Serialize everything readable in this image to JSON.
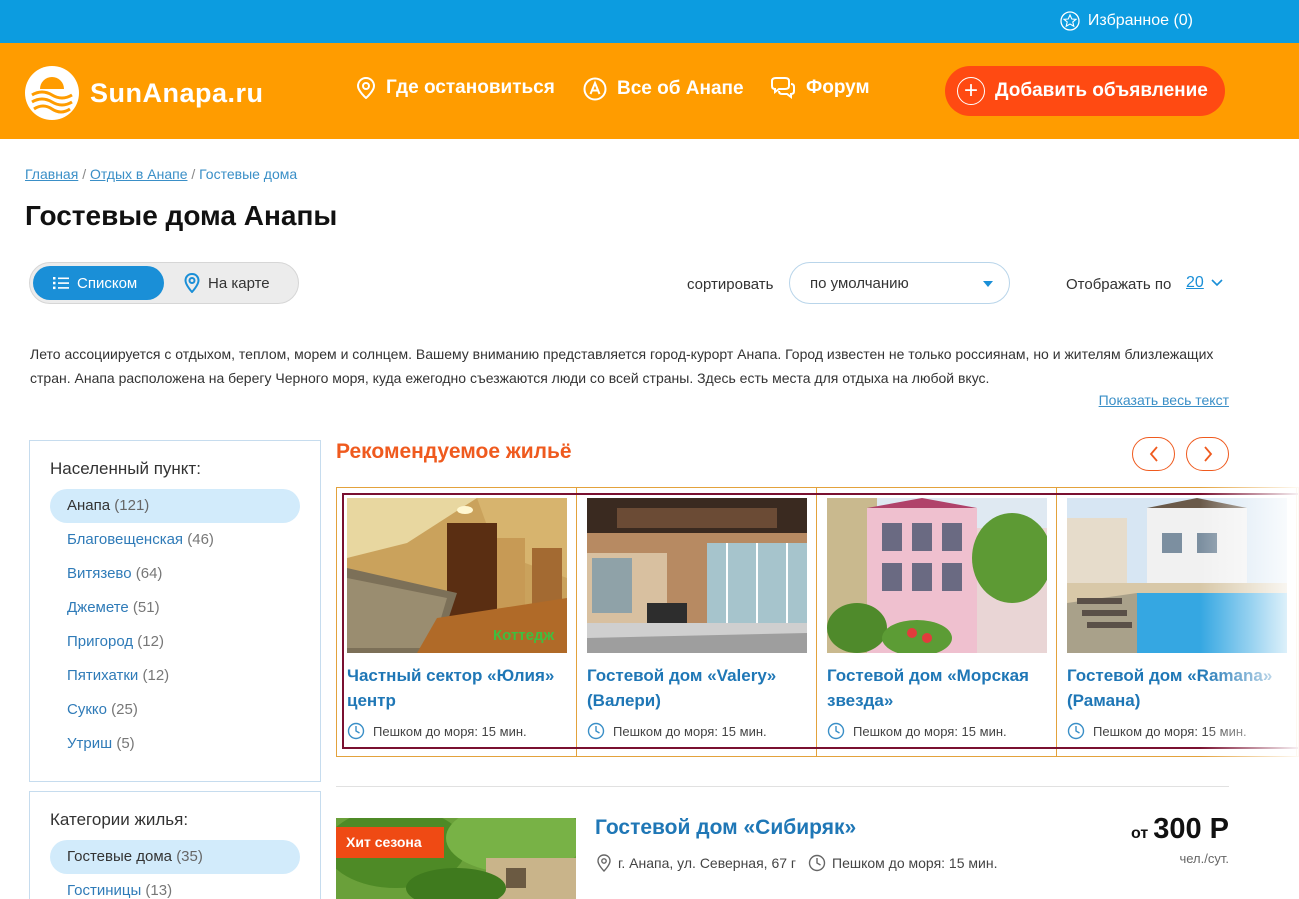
{
  "topbar": {
    "favorites_label": "Избранное (0)"
  },
  "header": {
    "logo_text": "SunAnapa.ru",
    "nav": [
      {
        "label": "Где остановиться",
        "icon": "location-pin-icon"
      },
      {
        "label": "Все об Анапе",
        "icon": "info-a-icon"
      },
      {
        "label": "Форум",
        "icon": "chat-bubbles-icon"
      }
    ],
    "add_button_label": "Добавить объявление"
  },
  "breadcrumb": {
    "items": [
      "Главная",
      "Отдых в Анапе"
    ],
    "separator": "/",
    "current": "Гостевые дома"
  },
  "page_title": "Гостевые дома Анапы",
  "view_toggle": {
    "list_label": "Списком",
    "map_label": "На карте",
    "active": "list"
  },
  "sort": {
    "label": "сортировать",
    "value": "по умолчанию"
  },
  "per_page": {
    "label": "Отображать по",
    "value": "20"
  },
  "intro": {
    "text": "Лето ассоциируется с отдыхом, теплом, морем и солнцем. Вашему вниманию представляется город-курорт Анапа. Город известен не только россиянам, но и жителям близлежащих стран. Анапа расположена на берегу Черного моря, куда ежегодно съезжаются люди со всей страны. Здесь есть места для отдыха на любой вкус.",
    "show_all_label": "Показать весь текст"
  },
  "filters": {
    "settlement": {
      "title": "Населенный пункт:",
      "items": [
        {
          "name": "Анапа",
          "count": "(121)",
          "active": true
        },
        {
          "name": "Благовещенская",
          "count": "(46)"
        },
        {
          "name": "Витязево",
          "count": "(64)"
        },
        {
          "name": "Джемете",
          "count": "(51)"
        },
        {
          "name": "Пригород",
          "count": "(12)"
        },
        {
          "name": "Пятихатки",
          "count": "(12)"
        },
        {
          "name": "Сукко",
          "count": "(25)"
        },
        {
          "name": "Утриш",
          "count": "(5)"
        }
      ]
    },
    "category": {
      "title": "Категории жилья:",
      "items": [
        {
          "name": "Гостевые дома",
          "count": "(35)",
          "active": true
        },
        {
          "name": "Гостиницы",
          "count": "(13)"
        }
      ]
    }
  },
  "recommended": {
    "title": "Рекомендуемое жильё",
    "cards": [
      {
        "title": "Частный сектор «Юлия» центр",
        "walk": "Пешком до моря: 15 мин.",
        "img_overlay": "Коттедж"
      },
      {
        "title": "Гостевой дом «Valery» (Валери)",
        "walk": "Пешком до моря: 15 мин."
      },
      {
        "title": "Гостевой дом «Морская звезда»",
        "walk": "Пешком до моря: 15 мин."
      },
      {
        "title": "Гостевой дом «Ramana» (Рамана)",
        "walk": "Пешком до моря: 15 мин."
      }
    ]
  },
  "listing": {
    "badge": "Хит сезона",
    "title": "Гостевой дом «Сибиряк»",
    "address": "г. Анапа, ул. Северная, 67 г",
    "walk": "Пешком до моря: 15 мин.",
    "price_from": "от",
    "price_value": "300 Р",
    "price_unit": "чел./сут."
  },
  "colors": {
    "topbar": "#0c9ce0",
    "header": "#ff9c00",
    "add_button": "#ff4a12",
    "accent_blue": "#1a8fd7",
    "recommended_title": "#ef5a1e",
    "link": "#1f77b6"
  }
}
